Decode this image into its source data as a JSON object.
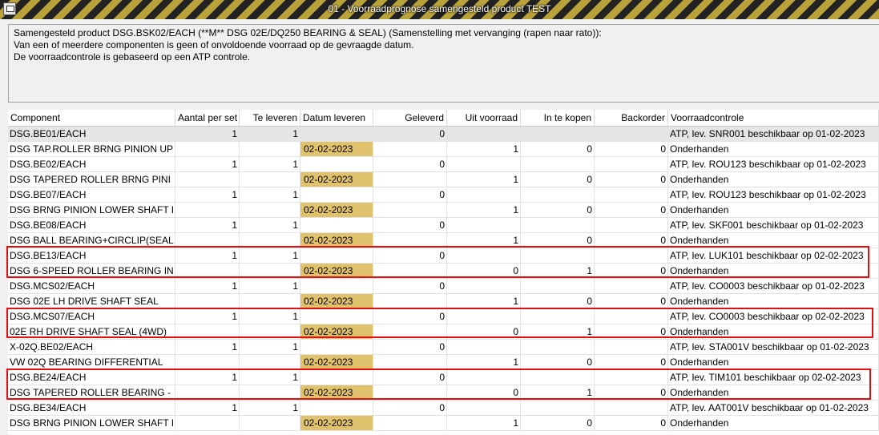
{
  "window": {
    "title": "01 - Voorraadprognose samengesteld product TEST"
  },
  "message": {
    "lines": [
      "Samengesteld product DSG.BSK02/EACH (**M** DSG 02E/DQ250 BEARING & SEAL) (Samenstelling met vervanging (rapen naar rato)):",
      "Van een of meerdere componenten is geen of onvoldoende voorraad op de gevraagde datum.",
      "De voorraadcontrole is gebaseerd op een ATP controle."
    ]
  },
  "table": {
    "columns": [
      "Component",
      "Aantal per set",
      "Te leveren",
      "Datum leveren",
      "Geleverd",
      "Uit voorraad",
      "In te kopen",
      "Backorder",
      "Voorraadcontrole"
    ],
    "rows": [
      [
        "DSG.BE01/EACH",
        "1",
        "1",
        "",
        "0",
        "",
        "",
        "",
        "ATP, lev. SNR001 beschikbaar op 01-02-2023"
      ],
      [
        "DSG TAP.ROLLER BRNG PINION UP",
        "",
        "",
        "02-02-2023",
        "",
        "1",
        "0",
        "0",
        "Onderhanden"
      ],
      [
        "DSG.BE02/EACH",
        "1",
        "1",
        "",
        "0",
        "",
        "",
        "",
        "ATP, lev. ROU123 beschikbaar op 01-02-2023"
      ],
      [
        "DSG TAPERED ROLLER BRNG PINI",
        "",
        "",
        "02-02-2023",
        "",
        "1",
        "0",
        "0",
        "Onderhanden"
      ],
      [
        "DSG.BE07/EACH",
        "1",
        "1",
        "",
        "0",
        "",
        "",
        "",
        "ATP, lev. ROU123 beschikbaar op 01-02-2023"
      ],
      [
        "DSG BRNG PINION LOWER SHAFT I",
        "",
        "",
        "02-02-2023",
        "",
        "1",
        "0",
        "0",
        "Onderhanden"
      ],
      [
        "DSG.BE08/EACH",
        "1",
        "1",
        "",
        "0",
        "",
        "",
        "",
        "ATP, lev. SKF001 beschikbaar op 01-02-2023"
      ],
      [
        "DSG BALL BEARING+CIRCLIP(SEAL",
        "",
        "",
        "02-02-2023",
        "",
        "1",
        "0",
        "0",
        "Onderhanden"
      ],
      [
        "DSG.BE13/EACH",
        "1",
        "1",
        "",
        "0",
        "",
        "",
        "",
        "ATP, lev. LUK101 beschikbaar op 02-02-2023"
      ],
      [
        "DSG 6-SPEED ROLLER BEARING IN",
        "",
        "",
        "02-02-2023",
        "",
        "0",
        "1",
        "0",
        "Onderhanden"
      ],
      [
        "DSG.MCS02/EACH",
        "1",
        "1",
        "",
        "0",
        "",
        "",
        "",
        "ATP, lev. CO0003 beschikbaar op 01-02-2023"
      ],
      [
        "DSG 02E LH DRIVE SHAFT SEAL",
        "",
        "",
        "02-02-2023",
        "",
        "1",
        "0",
        "0",
        "Onderhanden"
      ],
      [
        "DSG.MCS07/EACH",
        "1",
        "1",
        "",
        "0",
        "",
        "",
        "",
        "ATP, lev. CO0003 beschikbaar op 02-02-2023"
      ],
      [
        "02E RH DRIVE SHAFT SEAL (4WD)",
        "",
        "",
        "02-02-2023",
        "",
        "0",
        "1",
        "0",
        "Onderhanden"
      ],
      [
        "X-02Q.BE02/EACH",
        "1",
        "1",
        "",
        "0",
        "",
        "",
        "",
        "ATP, lev. STA001V beschikbaar op 01-02-2023"
      ],
      [
        "VW 02Q BEARING DIFFERENTIAL",
        "",
        "",
        "02-02-2023",
        "",
        "1",
        "0",
        "0",
        "Onderhanden"
      ],
      [
        "DSG.BE24/EACH",
        "1",
        "1",
        "",
        "0",
        "",
        "",
        "",
        "ATP, lev. TIM101 beschikbaar op 02-02-2023"
      ],
      [
        "DSG TAPERED ROLLER BEARING -",
        "",
        "",
        "02-02-2023",
        "",
        "0",
        "1",
        "0",
        "Onderhanden"
      ],
      [
        "DSG.BE34/EACH",
        "1",
        "1",
        "",
        "0",
        "",
        "",
        "",
        "ATP, lev. AAT001V beschikbaar op 01-02-2023"
      ],
      [
        "DSG BRNG PINION LOWER SHAFT I",
        "",
        "",
        "02-02-2023",
        "",
        "1",
        "0",
        "0",
        "Onderhanden"
      ]
    ]
  },
  "colors": {
    "date_cell": "#e0c26c",
    "highlight_box": "#e01010",
    "selected_row": "#e6e6e6"
  }
}
